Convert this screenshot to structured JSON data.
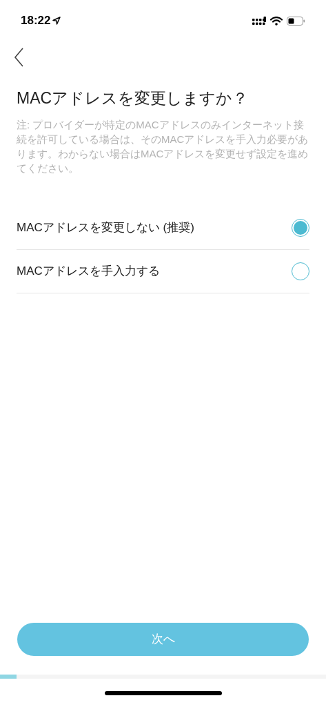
{
  "status_bar": {
    "time": "18:22"
  },
  "title": "MACアドレスを変更しますか？",
  "note": "注: プロバイダーが特定のMACアドレスのみインターネット接続を許可している場合は、そのMACアドレスを手入力必要があります。わからない場合はMACアドレスを変更せず設定を進めてください。",
  "options": [
    {
      "label": "MACアドレスを変更しない (推奨)",
      "selected": true
    },
    {
      "label": "MACアドレスを手入力する",
      "selected": false
    }
  ],
  "next_button": "次へ",
  "progress": {
    "level": 0.05
  }
}
